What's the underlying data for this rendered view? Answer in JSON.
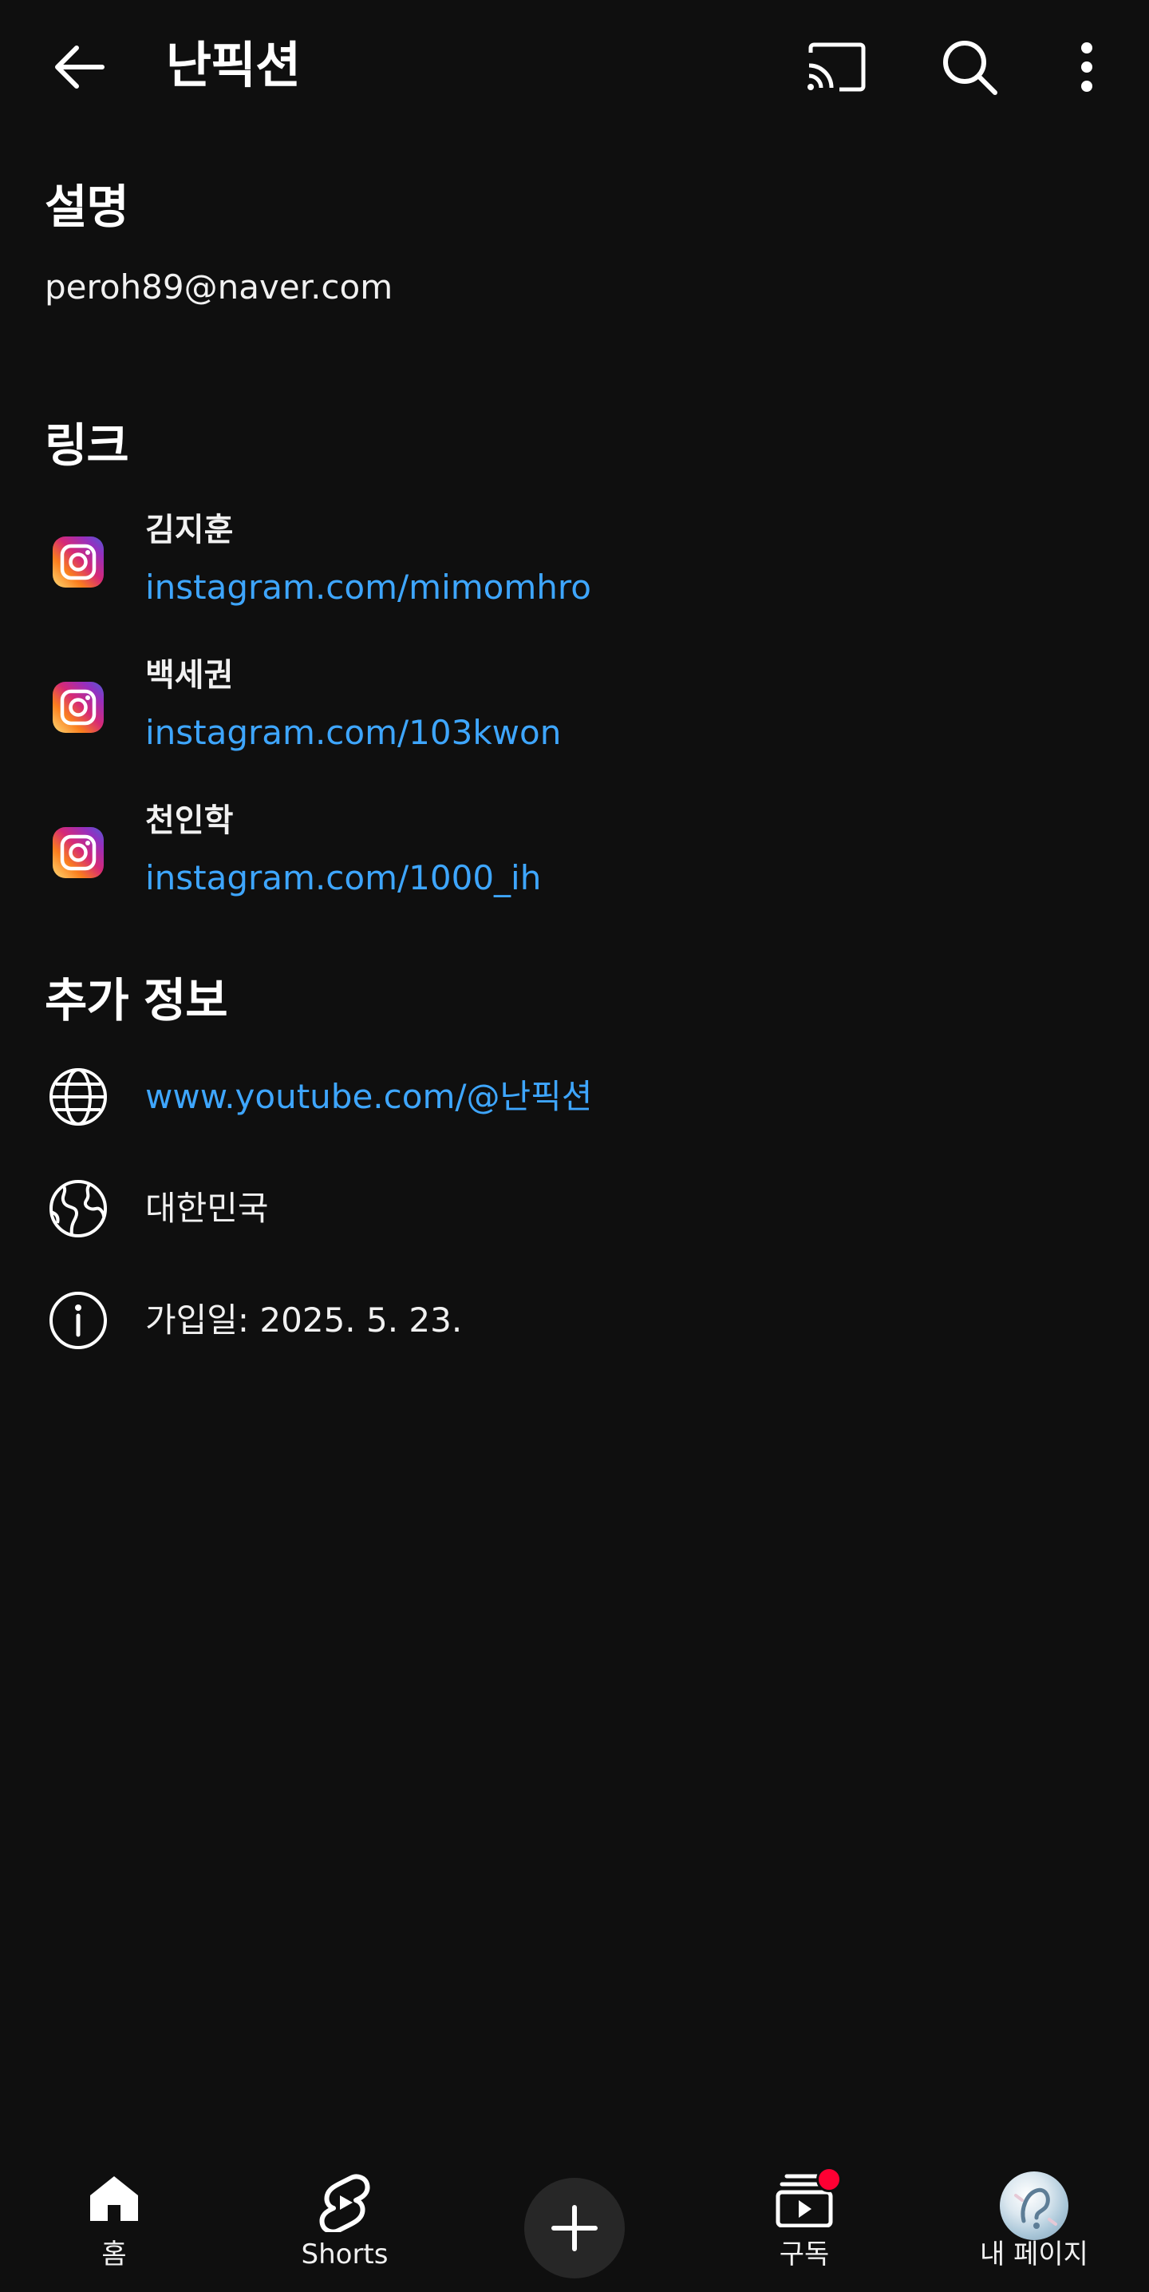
{
  "header": {
    "title": "난픽션",
    "back_icon": "arrow-left-icon",
    "cast_icon": "cast-icon",
    "search_icon": "search-icon",
    "more_icon": "more-vert-icon"
  },
  "description": {
    "heading": "설명",
    "text": "peroh89@naver.com"
  },
  "links": {
    "heading": "링크",
    "items": [
      {
        "name": "김지훈",
        "url": "instagram.com/mimomhro",
        "icon": "instagram-icon"
      },
      {
        "name": "백세권",
        "url": "instagram.com/103kwon",
        "icon": "instagram-icon"
      },
      {
        "name": "천인학",
        "url": "instagram.com/1000_ih",
        "icon": "instagram-icon"
      }
    ]
  },
  "more_info": {
    "heading": "추가 정보",
    "channel_url": "www.youtube.com/@난픽션",
    "country": "대한민국",
    "joined": "가입일: 2025. 5. 23."
  },
  "bottom_nav": {
    "home": "홈",
    "shorts": "Shorts",
    "create_icon": "plus-icon",
    "subscriptions": "구독",
    "you": "내 페이지"
  },
  "colors": {
    "background": "#0f0f0f",
    "text": "#ffffff",
    "link": "#3ea6ff",
    "notification": "#ff0033",
    "create_button": "#272727"
  }
}
